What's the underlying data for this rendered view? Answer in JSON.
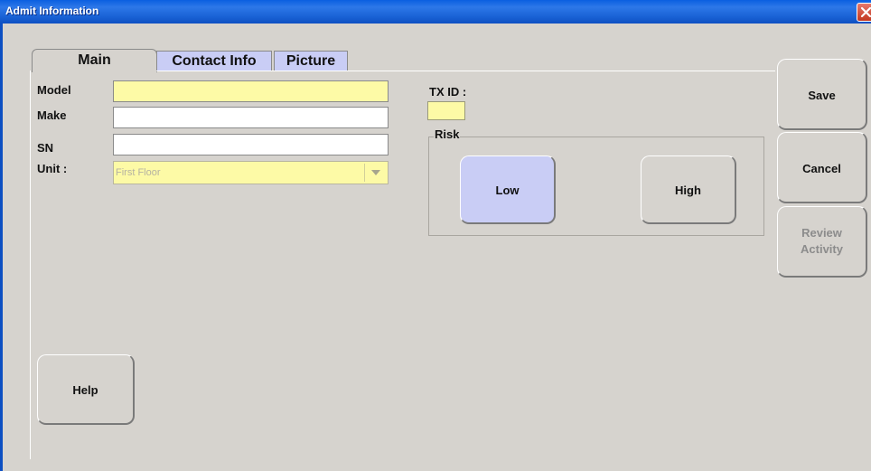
{
  "window": {
    "title": "Admit Information"
  },
  "tabs": [
    {
      "label": "Main",
      "active": true
    },
    {
      "label": "Contact Info",
      "active": false
    },
    {
      "label": "Picture",
      "active": false
    }
  ],
  "form": {
    "model_label": "Model",
    "model_value": "",
    "make_label": "Make",
    "make_value": "",
    "sn_label": "SN",
    "sn_value": "",
    "unit_label": "Unit :",
    "unit_value": "First Floor",
    "txid_label": "TX ID :",
    "txid_value": ""
  },
  "risk": {
    "label": "Risk",
    "low_label": "Low",
    "high_label": "High",
    "selected": "Low"
  },
  "actions": {
    "save_label": "Save",
    "cancel_label": "Cancel",
    "review_line1": "Review",
    "review_line2": "Activity",
    "help_label": "Help"
  },
  "colors": {
    "required_field": "#fdfaa6",
    "selected_button": "#c9cdf5",
    "title_bar": "#1a63d6"
  },
  "icons": {
    "close": "close-icon",
    "dropdown": "chevron-down-icon"
  }
}
